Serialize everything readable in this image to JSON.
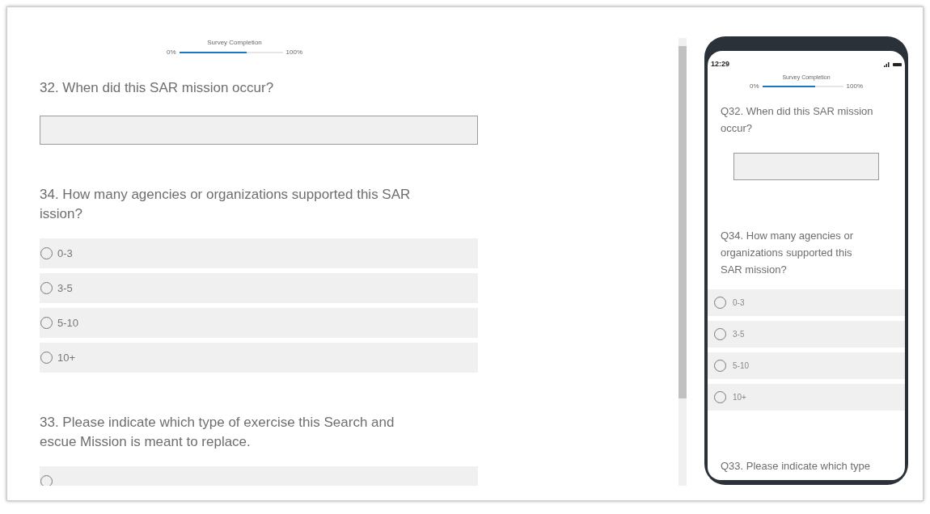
{
  "desktop": {
    "progress": {
      "label": "Survey Completion",
      "start": "0%",
      "end": "100%",
      "level": 0.65
    },
    "questions": [
      {
        "kind": "text",
        "lines": [
          "32. When did this SAR mission occur?"
        ]
      },
      {
        "kind": "radio",
        "lines": [
          "34. How many agencies or organizations supported this SAR",
          "ission?"
        ],
        "options": [
          {
            "label": "0-3",
            "selected": false
          },
          {
            "label": "3-5",
            "selected": false
          },
          {
            "label": "5-10",
            "selected": false
          },
          {
            "label": "10+",
            "selected": false
          }
        ]
      },
      {
        "kind": "radio",
        "lines": [
          "33. Please indicate which type of exercise this Search and",
          "escue Mission is meant to replace."
        ],
        "options": [
          {
            "selected": false
          }
        ]
      }
    ]
  },
  "phone": {
    "time": "12:29",
    "progress": {
      "label": "Survey Completion",
      "start": "0%",
      "end": "100%",
      "level": 0.65
    },
    "questions": [
      {
        "kind": "text",
        "lines": [
          "Q32. When did this SAR mission",
          "occur?"
        ]
      },
      {
        "kind": "radio",
        "lines": [
          "Q34. How many agencies or",
          "organizations supported this",
          "SAR mission?"
        ],
        "options": [
          {
            "label": "0-3",
            "selected": false
          },
          {
            "label": "3-5",
            "selected": false
          },
          {
            "label": "5-10",
            "selected": false
          },
          {
            "label": "10+",
            "selected": false
          }
        ]
      },
      {
        "kind": "radio",
        "lines": [
          "Q33. Please indicate which type"
        ]
      }
    ]
  }
}
